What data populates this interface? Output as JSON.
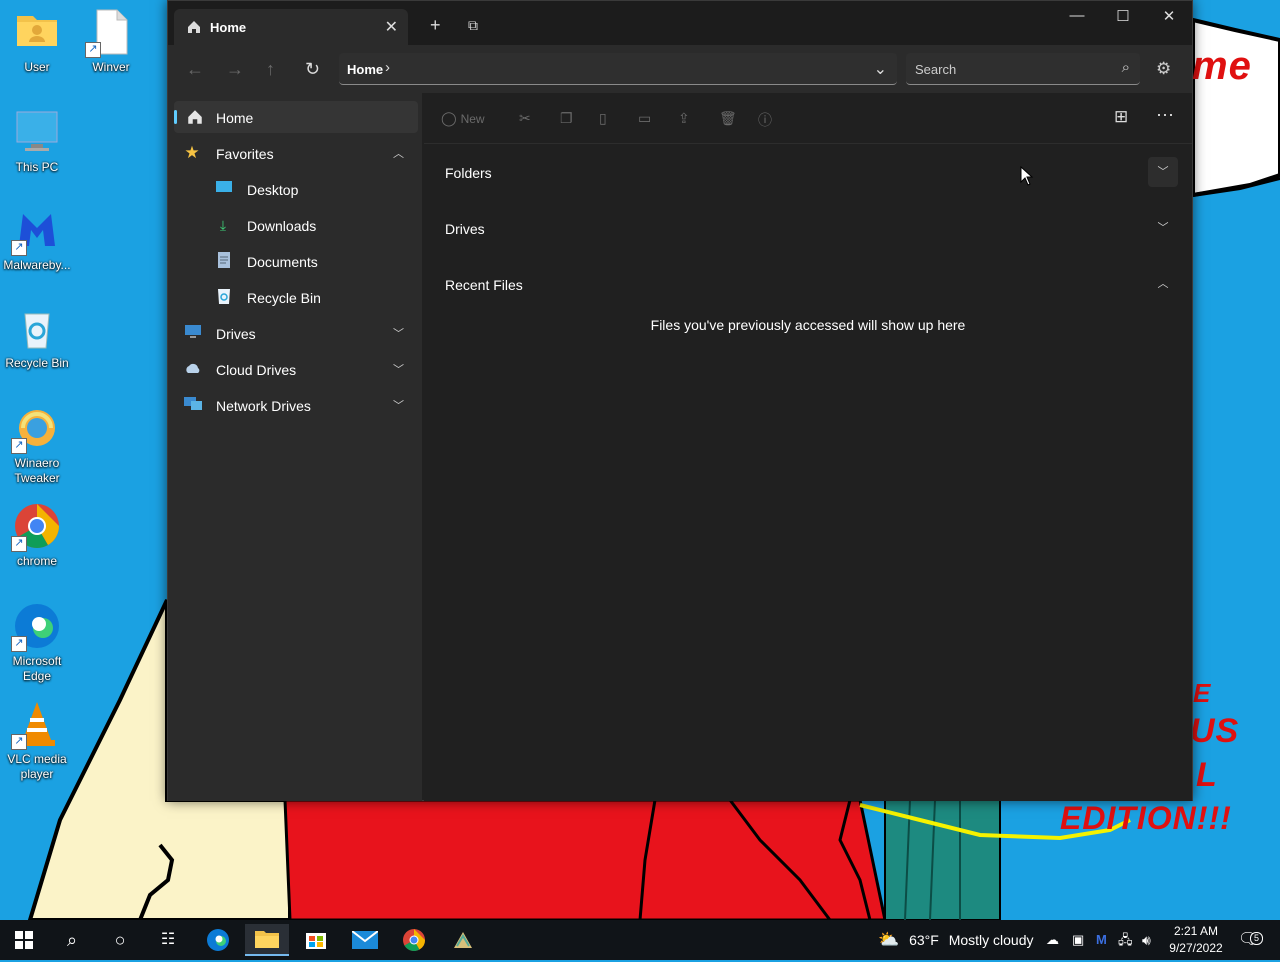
{
  "desktop": {
    "icons": [
      {
        "label": "User",
        "icon": "user-folder-icon"
      },
      {
        "label": "Winver",
        "icon": "document-icon"
      },
      {
        "label": "This PC",
        "icon": "monitor-icon"
      },
      {
        "label": "Malwareby...",
        "icon": "malwarebytes-icon"
      },
      {
        "label": "Recycle Bin",
        "icon": "recycle-bin-icon"
      },
      {
        "label": "Winaero Tweaker",
        "icon": "winaero-icon"
      },
      {
        "label": "chrome",
        "icon": "chrome-icon"
      },
      {
        "label": "Microsoft Edge",
        "icon": "edge-icon"
      },
      {
        "label": "VLC media player",
        "icon": "vlc-icon"
      }
    ],
    "wallpaper_text": {
      "top": "me",
      "bottom": [
        "E",
        "US",
        "L",
        "EDITION!!!"
      ]
    }
  },
  "window": {
    "tab": {
      "title": "Home"
    },
    "controls": {
      "minimize": "—",
      "maximize": "☐",
      "close": "✕"
    },
    "address": {
      "crumb": "Home",
      "separator": "›"
    },
    "search": {
      "placeholder": "Search"
    },
    "sidebar": [
      {
        "label": "Home",
        "icon": "home-icon",
        "selected": true
      },
      {
        "label": "Favorites",
        "icon": "star-icon",
        "expanded": true
      },
      {
        "label": "Desktop",
        "icon": "desktop-icon"
      },
      {
        "label": "Downloads",
        "icon": "download-icon"
      },
      {
        "label": "Documents",
        "icon": "documents-icon"
      },
      {
        "label": "Recycle Bin",
        "icon": "recycle-bin-icon"
      },
      {
        "label": "Drives",
        "icon": "drive-icon",
        "expanded": false
      },
      {
        "label": "Cloud Drives",
        "icon": "cloud-icon",
        "expanded": false
      },
      {
        "label": "Network Drives",
        "icon": "network-icon",
        "expanded": false
      }
    ],
    "commands": {
      "new_label": "New"
    },
    "sections": [
      {
        "title": "Folders",
        "expanded": false
      },
      {
        "title": "Drives",
        "expanded": false
      },
      {
        "title": "Recent Files",
        "expanded": true
      }
    ],
    "empty_message": "Files you've previously accessed will show up here"
  },
  "taskbar": {
    "weather": {
      "temp": "63°F",
      "condition": "Mostly cloudy"
    },
    "clock": {
      "time": "2:21 AM",
      "date": "9/27/2022"
    },
    "notifications": "5"
  },
  "colors": {
    "accent": "#60cdff",
    "desktop": "#1ba1e2",
    "window_bg": "#202020"
  }
}
